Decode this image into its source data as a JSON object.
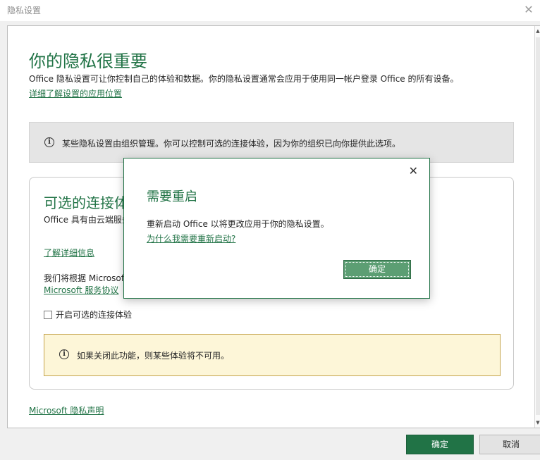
{
  "window": {
    "title": "隐私设置"
  },
  "main": {
    "heading": "你的隐私很重要",
    "subtext": "Office 隐私设置可让你控制自己的体验和数据。你的隐私设置通常会应用于使用同一帐户登录 Office 的所有设备。",
    "learn_location_link": "详细了解设置的应用位置",
    "org_notice": "某些隐私设置由组织管理。你可以控制可选的连接体验，因为你的组织已向你提供此选项。",
    "card": {
      "title": "可选的连接体验",
      "description": "Office 具有由云端服务提供支持的可选连接体验，例如在线搜索要添加到幻灯片的联机图片的体验。",
      "learn_more_link": "了解详细信息",
      "basis_text": "我们将根据 Microsoft",
      "service_link": "Microsoft 服务协议",
      "checkbox_label": "开启可选的连接体验",
      "warning_text": "如果关闭此功能，则某些体验将不可用。"
    },
    "privacy_statement_link": "Microsoft 隐私声明"
  },
  "footer": {
    "ok_label": "确定",
    "cancel_label": "取消"
  },
  "modal": {
    "title": "需要重启",
    "text": "重新启动 Office 以将更改应用于你的隐私设置。",
    "link": "为什么我需要重新启动?",
    "ok_label": "确定"
  },
  "colors": {
    "accent": "#217346",
    "warning_bg": "#fdf6d8",
    "notice_bg": "#e5e5e5"
  }
}
